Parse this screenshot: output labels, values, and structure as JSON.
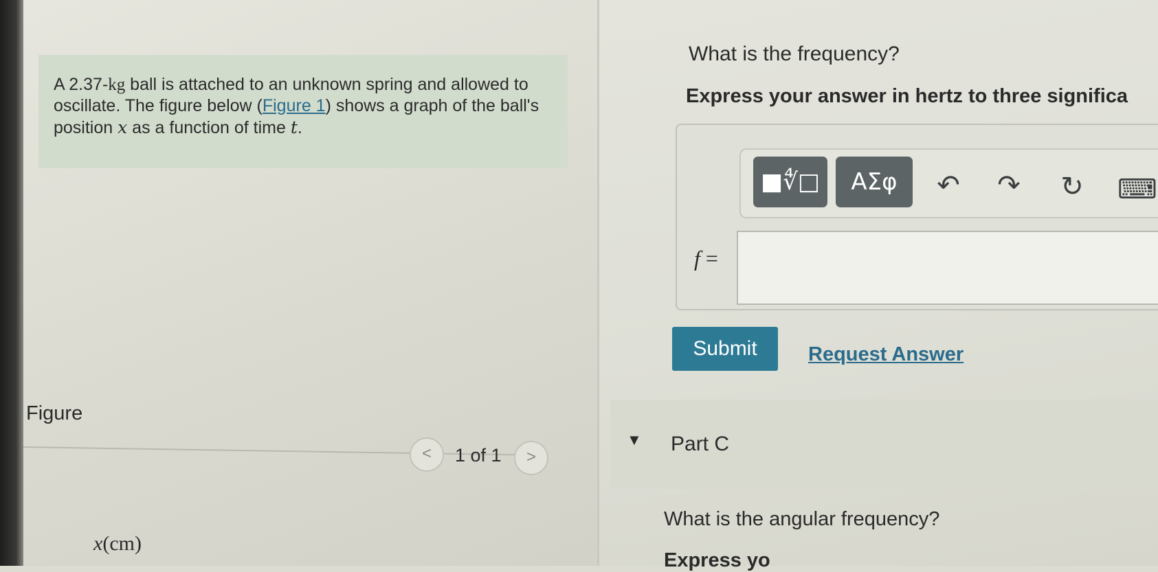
{
  "problem": {
    "intro": "A 2.37-",
    "unit": "kg",
    "text_after_unit": " ball is attached to an unknown spring and allowed to oscillate. The figure below (",
    "figure_link": "Figure 1",
    "text_after_link": ") shows a graph of the ball's position ",
    "var_x": "x",
    "text_mid": " as a function of time ",
    "var_t": "t",
    "text_end": "."
  },
  "figure": {
    "title": "Figure",
    "prev_symbol": "<",
    "next_symbol": ">",
    "page_count": "1 of 1",
    "axis_label_var": "x",
    "axis_label_unit": "(cm)"
  },
  "part_b": {
    "question": "What is the frequency?",
    "instruction": "Express your answer in hertz to three significa",
    "toolbar": {
      "templates_symbol": "■∜□",
      "greek_symbol": "ΑΣφ",
      "undo_icon": "↶",
      "redo_icon": "↷",
      "reset_icon": "↻",
      "keyboard_icon": "⌨"
    },
    "answer_var": "f",
    "answer_eq": " =",
    "answer_value": "",
    "submit_label": "Submit",
    "request_label": "Request Answer"
  },
  "part_c": {
    "caret": "▼",
    "title": "Part C",
    "question": "What is the angular frequency?",
    "next_line": "Express yo"
  },
  "colors": {
    "accent": "#2d7a95",
    "link": "#2a6b8c",
    "toolbar_button": "#5d6466",
    "problem_box": "#d2dccd"
  }
}
